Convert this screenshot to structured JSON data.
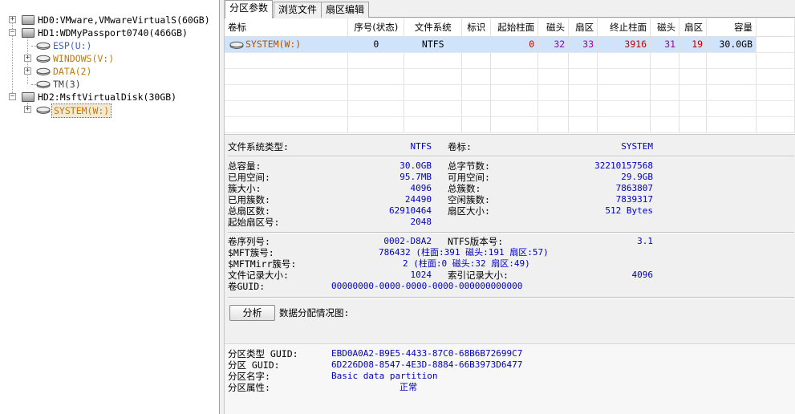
{
  "tree": {
    "disks": [
      {
        "label": "HD0:VMware,VMwareVirtualS(60GB)",
        "expander": "+"
      },
      {
        "label": "HD1:WDMyPassport0740(466GB)",
        "expander": "−",
        "partitions": [
          {
            "label": "ESP(U:)",
            "color": "#3a64c8"
          },
          {
            "label": "WINDOWS(V:)",
            "color": "#c87800"
          },
          {
            "label": "DATA(2)",
            "color": "#c87800"
          },
          {
            "label": "TM(3)",
            "color": "#404040"
          }
        ]
      },
      {
        "label": "HD2:MsftVirtualDisk(30GB)",
        "expander": "−",
        "partitions": [
          {
            "label": "SYSTEM(W:)",
            "color": "#c87800"
          }
        ]
      }
    ]
  },
  "tabs": [
    "分区参数",
    "浏览文件",
    "扇区编辑"
  ],
  "grid": {
    "headers": [
      "卷标",
      "序号(状态)",
      "文件系统",
      "标识",
      "起始柱面",
      "磁头",
      "扇区",
      "终止柱面",
      "磁头",
      "扇区",
      "容量"
    ],
    "rows": [
      {
        "volume": "SYSTEM(W:)",
        "index": "0",
        "fs": "NTFS",
        "flag": "",
        "start_cyl": "0",
        "start_head": "32",
        "start_sec": "33",
        "end_cyl": "3916",
        "end_head": "31",
        "end_sec": "19",
        "capacity": "30.0GB"
      }
    ]
  },
  "info": {
    "fs_type_label": "文件系统类型:",
    "fs_type_value": "NTFS",
    "vol_label_label": "卷标:",
    "vol_label_value": "SYSTEM",
    "total_capacity_label": "总容量:",
    "total_capacity_value": "30.0GB",
    "total_bytes_label": "总字节数:",
    "total_bytes_value": "32210157568",
    "used_space_label": "已用空间:",
    "used_space_value": "95.7MB",
    "free_space_label": "可用空间:",
    "free_space_value": "29.9GB",
    "cluster_size_label": "簇大小:",
    "cluster_size_value": "4096",
    "total_clusters_label": "总簇数:",
    "total_clusters_value": "7863807",
    "used_clusters_label": "已用簇数:",
    "used_clusters_value": "24490",
    "free_clusters_label": "空闲簇数:",
    "free_clusters_value": "7839317",
    "total_sectors_label": "总扇区数:",
    "total_sectors_value": "62910464",
    "sector_size_label": "扇区大小:",
    "sector_size_value": "512 Bytes",
    "start_sector_label": "起始扇区号:",
    "start_sector_value": "2048",
    "serial_label": "卷序列号:",
    "serial_value": "0002-D8A2",
    "ntfs_ver_label": "NTFS版本号:",
    "ntfs_ver_value": "3.1",
    "mft_label": "$MFT簇号:",
    "mft_value": "786432 (柱面:391 磁头:191 扇区:57)",
    "mftmirr_label": "$MFTMirr簇号:",
    "mftmirr_value": "2 (柱面:0 磁头:32 扇区:49)",
    "record_size_label": "文件记录大小:",
    "record_size_value": "1024",
    "index_size_label": "索引记录大小:",
    "index_size_value": "4096",
    "vol_guid_label": "卷GUID:",
    "vol_guid_value": "00000000-0000-0000-0000-000000000000",
    "analyze_button": "分析",
    "distribution_label": "数据分配情况图:",
    "ptype_guid_label": "分区类型 GUID:",
    "ptype_guid_value": "EBD0A0A2-B9E5-4433-87C0-68B6B72699C7",
    "part_guid_label": "分区 GUID:",
    "part_guid_value": "6D226D08-8547-4E3D-8884-66B3973D6477",
    "part_name_label": "分区名字:",
    "part_name_value": "Basic data partition",
    "part_attr_label": "分区属性:",
    "part_attr_value": "正常"
  }
}
